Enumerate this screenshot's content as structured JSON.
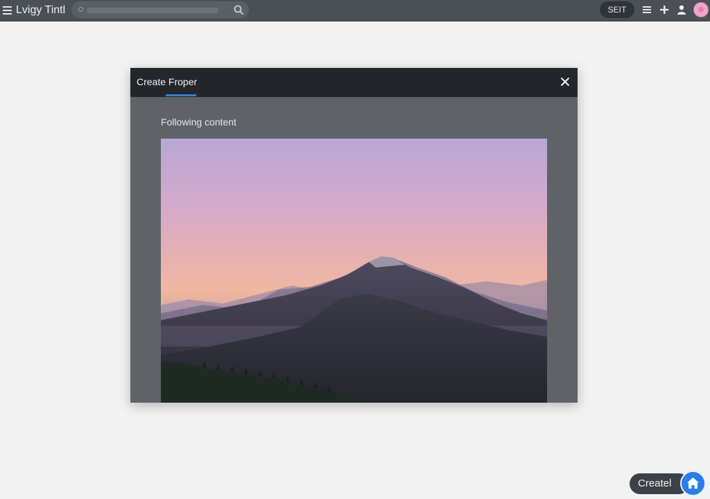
{
  "app": {
    "title": "Lvigy Tintl"
  },
  "search": {
    "placeholder": "",
    "value": ""
  },
  "topbar": {
    "pill_label": "SEIT",
    "icons": [
      "menu-icon",
      "list-icon",
      "plus-icon",
      "user-icon",
      "avatar"
    ]
  },
  "modal": {
    "title": "Create Froper",
    "section_label": "Following content",
    "image": "mountain-sunset-photo"
  },
  "fab": {
    "create_label": "Createl",
    "icon": "home-icon"
  },
  "colors": {
    "topbar": "#4a5055",
    "modal_header": "#23262a",
    "modal_body": "#5f6367",
    "accent": "#3a7bd5",
    "fab": "#2b7de9",
    "background": "#f2f2f2"
  }
}
